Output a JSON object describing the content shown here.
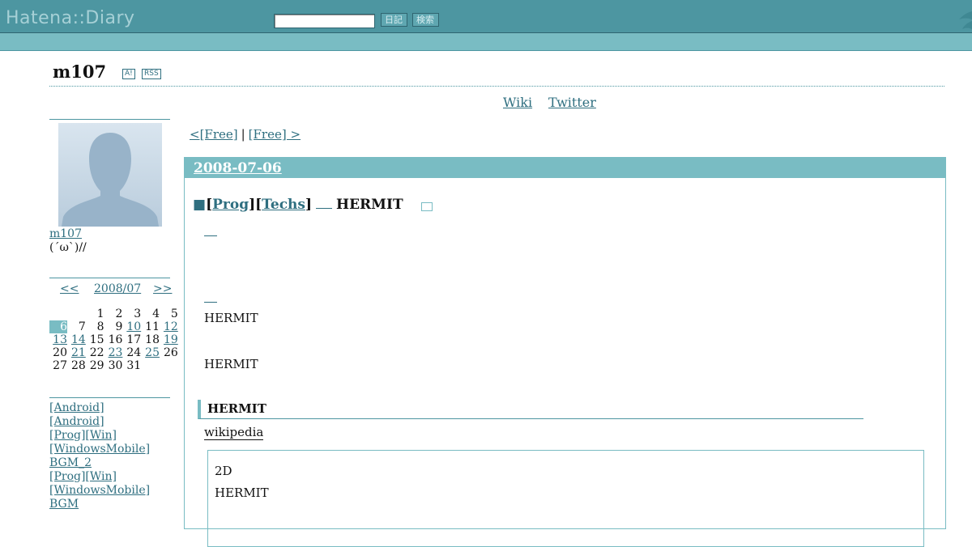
{
  "topbar": {
    "logo": "Hatena::Diary",
    "search_placeholder": "",
    "diary_button": "日記",
    "search_button": "検索"
  },
  "header": {
    "title": "m107",
    "antenna_badge": "A!",
    "rss_badge": "RSS",
    "links": [
      "Wiki",
      "Twitter",
      ""
    ]
  },
  "profile": {
    "name": "m107",
    "description": "(´ω`)//"
  },
  "calendar": {
    "prev": "<<",
    "month": "2008/07",
    "next": ">>",
    "today": "6",
    "linked_days": [
      "6",
      "10",
      "12",
      "13",
      "14",
      "19",
      "21",
      "23",
      "25"
    ],
    "weeks": [
      [
        "",
        "",
        "1",
        "2",
        "3",
        "4",
        "5"
      ],
      [
        "6",
        "7",
        "8",
        "9",
        "10",
        "11",
        "12"
      ],
      [
        "13",
        "14",
        "15",
        "16",
        "17",
        "18",
        "19"
      ],
      [
        "20",
        "21",
        "22",
        "23",
        "24",
        "25",
        "26"
      ],
      [
        "27",
        "28",
        "29",
        "30",
        "31",
        "",
        ""
      ]
    ]
  },
  "recent_entries": [
    "[Android]",
    "[Android]",
    "[Prog][Win]",
    "[WindowsMobile]",
    "BGM_2",
    "[Prog][Win]",
    "[WindowsMobile]",
    "BGM"
  ],
  "pager": {
    "prev": "<[Free]",
    "separator": "|",
    "next": "[Free] >"
  },
  "entry": {
    "date": "2008-07-06",
    "square": "■",
    "category_1": "Prog",
    "category_2": "Techs",
    "title": "HERMIT",
    "paragraph_1": "HERMIT",
    "paragraph_2": "HERMIT",
    "subsection_title": "HERMIT",
    "wiki_link": "wikipedia",
    "quote_line_1": "2D",
    "quote_line_2": "HERMIT"
  },
  "colors": {
    "topbar": "#4d96a1",
    "subbar": "#79bcc3",
    "link": "#2f6f80",
    "accent": "#79bcc3"
  }
}
